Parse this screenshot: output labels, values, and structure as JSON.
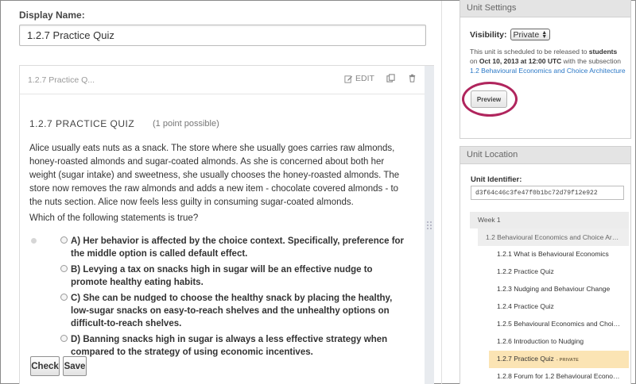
{
  "display_name": {
    "label": "Display Name:",
    "value": "1.2.7 Practice Quiz"
  },
  "component": {
    "header_title": "1.2.7 Practice Q...",
    "edit_label": "EDIT",
    "quiz_title": "1.2.7 PRACTICE QUIZ",
    "points": "(1 point possible)",
    "body": "Alice usually eats nuts as a snack. The store where she usually goes carries raw almonds, honey-roasted almonds and sugar-coated almonds. As she is concerned about both her weight (sugar intake) and sweetness, she usually chooses the honey-roasted almonds. The store now removes the raw almonds and adds a new item - chocolate covered almonds - to the nuts section. Alice now feels less guilty in consuming sugar-coated almonds.",
    "question": "Which of the following statements is true?",
    "choices": [
      "A) Her behavior is affected by the choice context. Specifically, preference for the middle option is called default effect.",
      "B) Levying a tax on snacks high in sugar will be an effective nudge to promote healthy eating habits.",
      "C) She can be nudged to choose the healthy snack by placing the healthy, low-sugar snacks on easy-to-reach shelves and the unhealthy options on difficult-to-reach shelves.",
      "D) Banning snacks high in sugar is always a less effective strategy when compared to the strategy of using economic incentives."
    ],
    "check_label": "Check",
    "save_label": "Save"
  },
  "unit_settings": {
    "title": "Unit Settings",
    "visibility_label": "Visibility:",
    "visibility_value": "Private",
    "release_prefix": "This unit is scheduled to be released to ",
    "release_students": "students",
    "release_on": " on ",
    "release_date": "Oct 10, 2013 at 12:00 UTC",
    "release_middle": " with the subsection ",
    "release_subsection": "1.2 Behavioural Economics and Choice Architecture",
    "preview_label": "Preview",
    "highlight_color": "#b0255d"
  },
  "unit_location": {
    "title": "Unit Location",
    "identifier_label": "Unit Identifier:",
    "identifier_value": "d3f64c46c3fe47f0b1bc72d79f12e922",
    "week": "Week 1",
    "subsection": "1.2 Behavioural Economics and Choice Archit...",
    "units": [
      "1.2.1 What is Behavioural Economics",
      "1.2.2 Practice Quiz",
      "1.2.3 Nudging and Behaviour Change",
      "1.2.4 Practice Quiz",
      "1.2.5 Behavioural Economics and Choice ...",
      "1.2.6 Introduction to Nudging",
      "1.2.7 Practice Quiz",
      "1.2.8 Forum for 1.2 Behavioural Economic..."
    ],
    "active_index": 6,
    "private_tag": "- PRIVATE"
  }
}
